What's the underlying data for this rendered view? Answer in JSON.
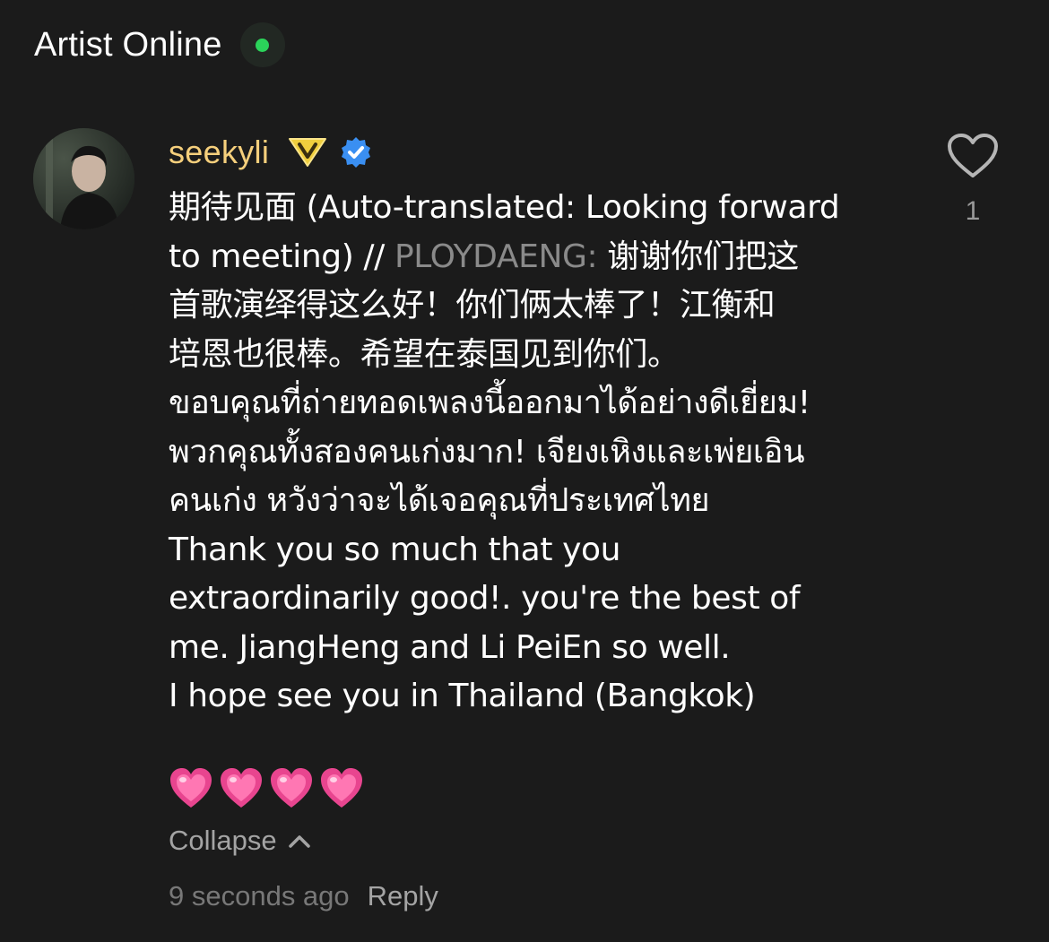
{
  "header": {
    "title": "Artist Online",
    "status_color": "#2bd45a"
  },
  "comment": {
    "username": "seekyli",
    "username_color": "#f5cf7c",
    "badges": [
      "vip-badge-icon",
      "verified-badge-icon"
    ],
    "text_before_mention": "期待见面 (Auto-translated: Looking forward\nto meeting) // ",
    "mention": "PLOYDAENG:",
    "text_after_mention": " 谢谢你们把这\n首歌演绎得这么好！你们俩太棒了！江衡和\n培恩也很棒。希望在泰国见到你们。\nขอบคุณที่ถ่ายทอดเพลงนี้ออกมาได้อย่างดีเยี่ยม!\nพวกคุณทั้งสองคนเก่งมาก! เจียงเหิงและเพ่ยเอิน\nคนเก่ง หวังว่าจะได้เจอคุณที่ประเทศไทย\nThank you so much that you\nextraordinarily good!. you're the best of\nme. JiangHeng and Li PeiEn so well.\nI hope see you in Thailand (Bangkok)",
    "emojis": [
      "heart-emoji",
      "heart-emoji",
      "heart-emoji",
      "heart-emoji"
    ],
    "collapse_label": "Collapse",
    "timestamp": "9 seconds ago",
    "reply_label": "Reply",
    "like_count": "1"
  }
}
